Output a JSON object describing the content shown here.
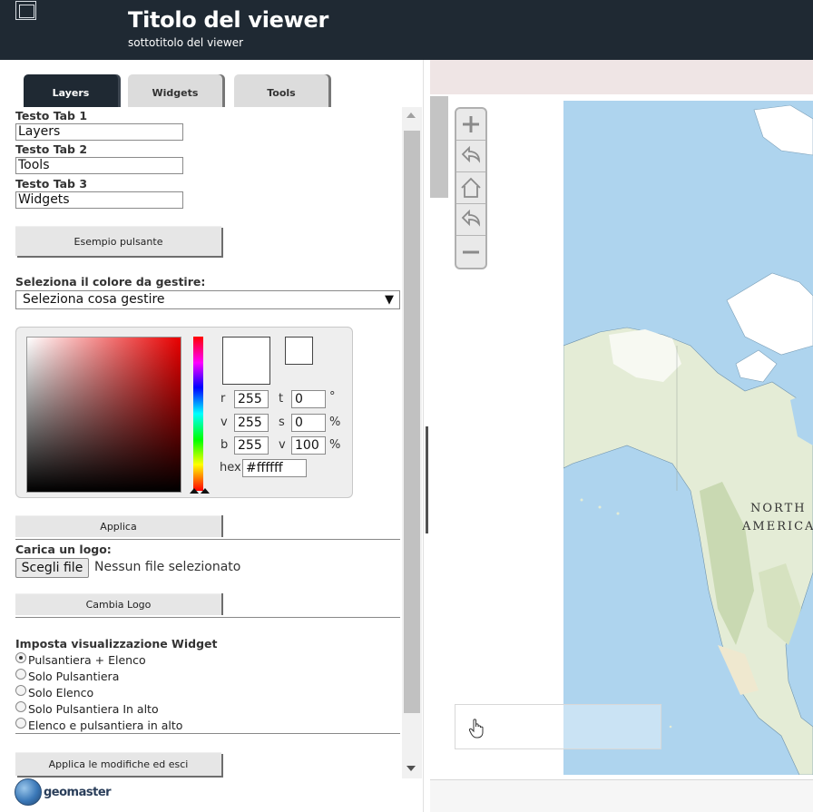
{
  "header": {
    "title": "Titolo del viewer",
    "subtitle": "sottotitolo del viewer"
  },
  "tabs": [
    {
      "label": "Layers",
      "active": true
    },
    {
      "label": "Widgets",
      "active": false
    },
    {
      "label": "Tools",
      "active": false
    }
  ],
  "form": {
    "tab1": {
      "label": "Testo Tab 1",
      "value": "Layers"
    },
    "tab2": {
      "label": "Testo Tab 2",
      "value": "Tools"
    },
    "tab3": {
      "label": "Testo Tab 3",
      "value": "Widgets"
    },
    "example_button": "Esempio pulsante",
    "color_select": {
      "label": "Seleziona il colore da gestire:",
      "value": "Seleziona cosa gestire"
    },
    "color_picker": {
      "r_label": "r",
      "r": "255",
      "g_label": "v",
      "g": "255",
      "b_label": "b",
      "b": "255",
      "h_label": "t",
      "h": "0",
      "h_unit": "°",
      "s_label": "s",
      "s": "0",
      "s_unit": "%",
      "v_label": "v",
      "v": "100",
      "v_unit": "%",
      "hex_label": "hex",
      "hex": "#ffffff"
    },
    "apply_button": "Applica",
    "logo_label": "Carica un logo:",
    "file_button": "Scegli file",
    "file_status": "Nessun file selezionato",
    "change_logo_button": "Cambia Logo",
    "widget_label": "Imposta visualizzazione Widget",
    "widget_options": [
      {
        "label": "Pulsantiera + Elenco",
        "selected": true
      },
      {
        "label": "Solo Pulsantiera",
        "selected": false
      },
      {
        "label": "Solo Elenco",
        "selected": false
      },
      {
        "label": "Solo Pulsantiera In alto",
        "selected": false
      },
      {
        "label": "Elenco e pulsantiera in alto",
        "selected": false
      }
    ],
    "save_button": "Applica le modifiche ed esci"
  },
  "footer": {
    "logo_text": "geomaster"
  },
  "map": {
    "label_line1": "NORTH",
    "label_line2": "AMERICA",
    "zoom_controls": [
      "zoom-in-icon",
      "back-icon",
      "home-icon",
      "forward-icon",
      "zoom-out-icon"
    ]
  },
  "colors": {
    "header_bg": "#1f2933",
    "ocean": "#aed4ee",
    "land": "#e8efd8"
  }
}
